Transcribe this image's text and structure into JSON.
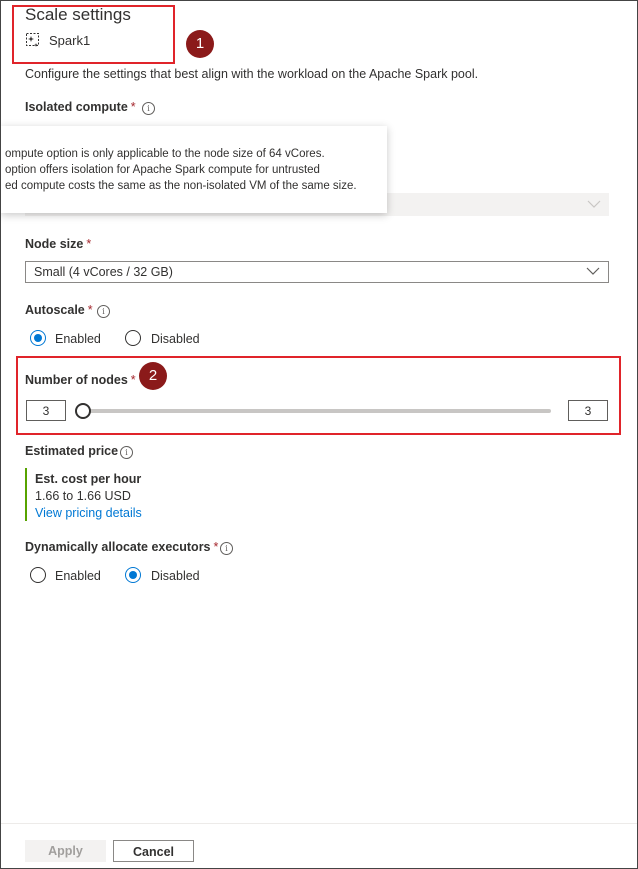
{
  "panel": {
    "title": "Scale settings",
    "pool_name": "Spark1",
    "description": "Configure the settings that best align with the workload on the Apache Spark pool."
  },
  "isolated_compute": {
    "label": "Isolated compute",
    "required": "*",
    "info_icon": "info-icon",
    "tooltip_lines": [
      "ompute option is only applicable to the node size of 64 vCores.",
      "option offers isolation for Apache Spark compute for untrusted",
      "ed compute costs the same as the non-isolated VM of the same size."
    ]
  },
  "node_size": {
    "label": "Node size",
    "required": "*",
    "value": "Small (4 vCores / 32 GB)"
  },
  "autoscale": {
    "label": "Autoscale",
    "required": "*",
    "options": [
      "Enabled",
      "Disabled"
    ],
    "selected": "Enabled"
  },
  "number_of_nodes": {
    "label": "Number of nodes",
    "required": "*",
    "min_value": "3",
    "max_value": "3"
  },
  "estimated_price": {
    "label": "Estimated price",
    "heading": "Est. cost per hour",
    "value": "1.66 to 1.66 USD",
    "link": "View pricing details"
  },
  "dynamic_executors": {
    "label": "Dynamically allocate executors",
    "required": "*",
    "options": [
      "Enabled",
      "Disabled"
    ],
    "selected": "Disabled"
  },
  "annotations": {
    "marker_1": "1",
    "marker_2": "2"
  },
  "footer": {
    "apply_label": "Apply",
    "cancel_label": "Cancel"
  },
  "colors": {
    "accent": "#0078d4",
    "required": "#a4262c",
    "highlight": "#e0242a",
    "marker": "#8b1a1a",
    "price_bar": "#57a300"
  }
}
